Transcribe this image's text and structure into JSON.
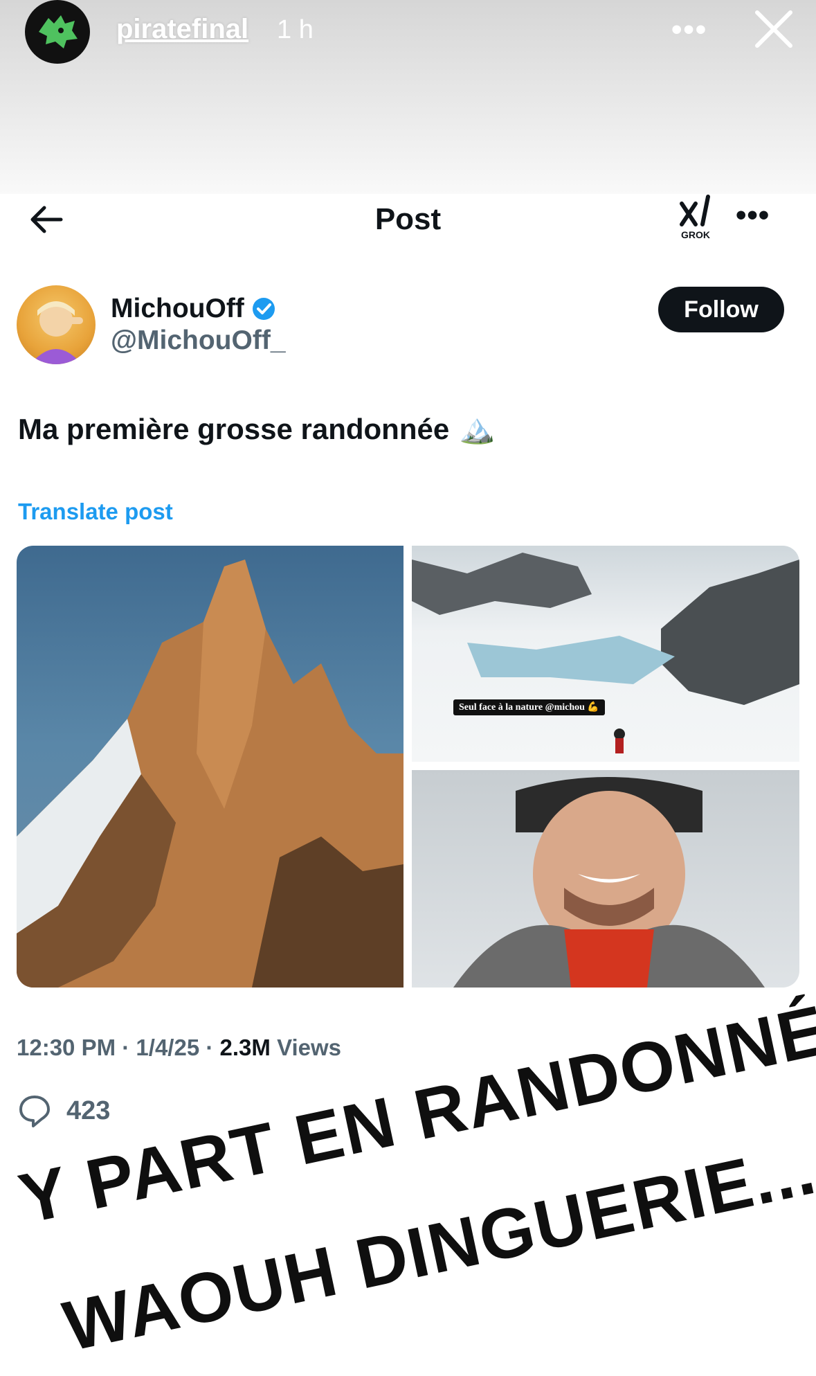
{
  "story": {
    "username": "piratefinal",
    "time": "1 h",
    "more_icon": "more-dots-icon",
    "close_icon": "close-icon"
  },
  "header": {
    "title": "Post",
    "grok_label": "GROK"
  },
  "author": {
    "name": "MichouOff",
    "handle": "@MichouOff_",
    "verified": true,
    "follow_label": "Follow"
  },
  "post": {
    "text": "Ma première grosse randonnée",
    "emoji": "🏔️",
    "translate_label": "Translate post",
    "image_caption": "Seul face à la nature @michou 💪"
  },
  "meta": {
    "time": "12:30 PM",
    "date": "1/4/25",
    "views": "2.3M",
    "views_label": "Views"
  },
  "actions": {
    "replies": "423"
  },
  "overlay": {
    "line1": "Y PART EN RANDONNÉE",
    "line2": "WAOUH DINGUERIE..."
  },
  "colors": {
    "accent": "#1d9bf0",
    "text": "#0f1419",
    "muted": "#536471"
  }
}
